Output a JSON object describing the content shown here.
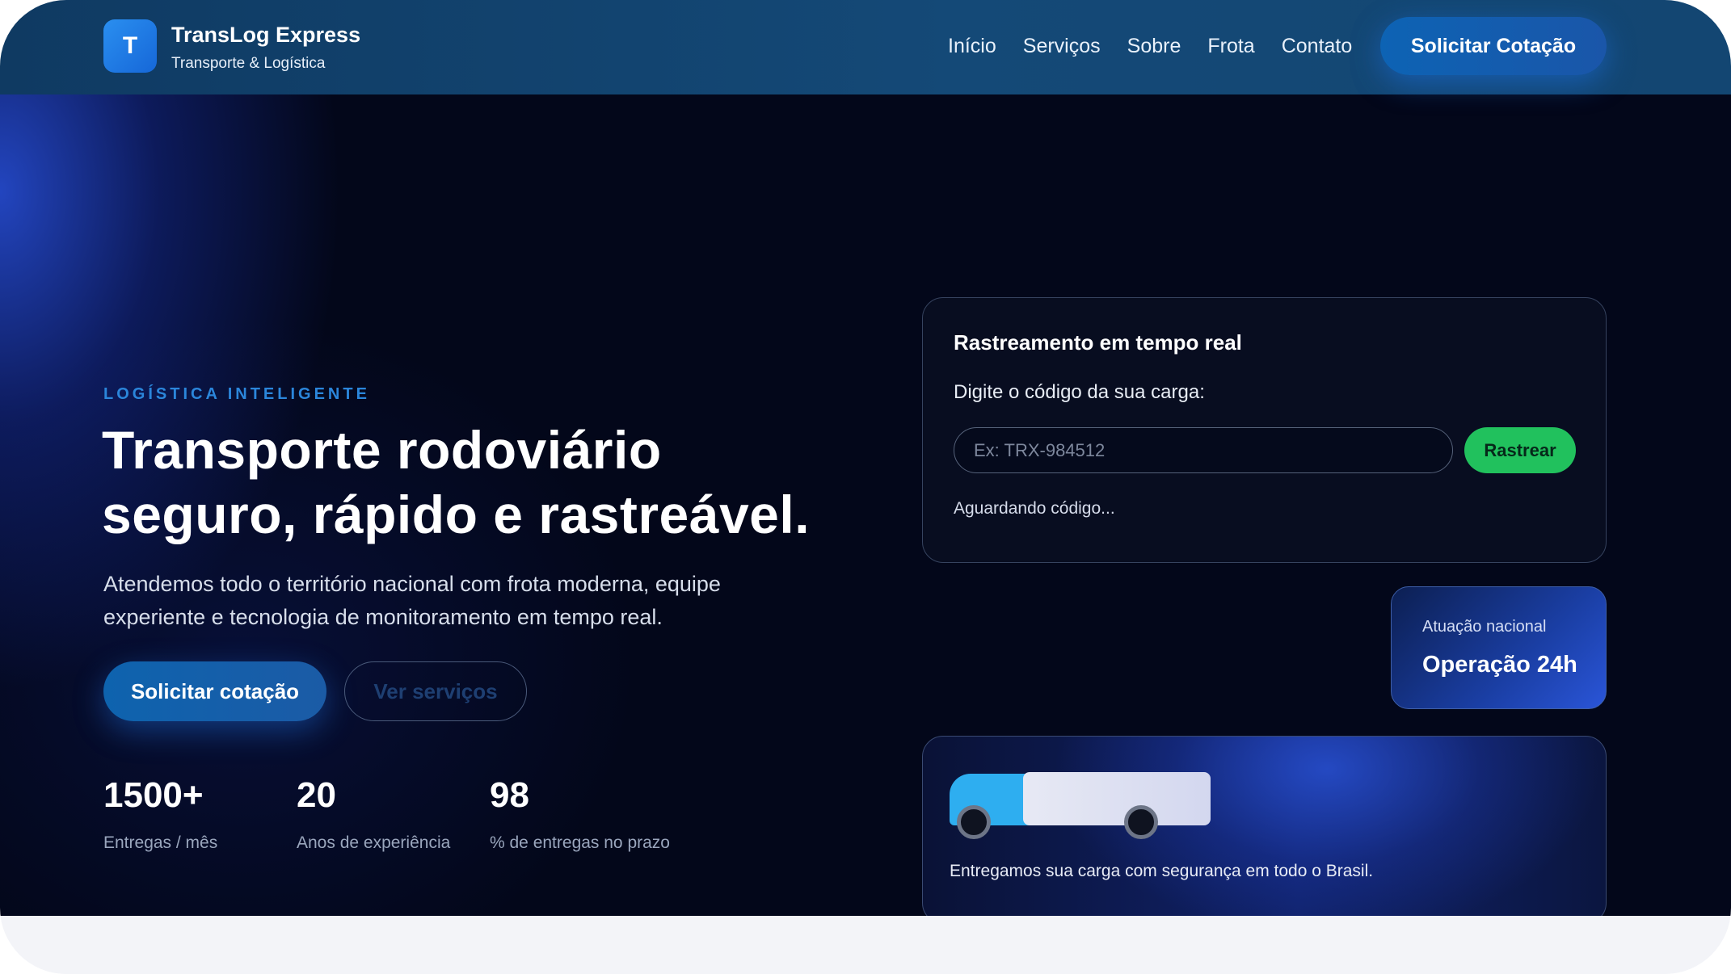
{
  "nav": {
    "brand_initial": "T",
    "brand_name": "TransLog Express",
    "brand_sub": "Transporte & Logística",
    "links": [
      "Início",
      "Serviços",
      "Sobre",
      "Frota",
      "Contato"
    ],
    "cta": "Solicitar Cotação"
  },
  "hero": {
    "eyebrow": "LOGÍSTICA INTELIGENTE",
    "headline_line1": "Transporte rodoviário",
    "headline_line2": "seguro, rápido e rastreável.",
    "subtext": "Atendemos todo o território nacional com frota moderna, equipe experiente e tecnologia de monitoramento em tempo real.",
    "primary_button": "Solicitar cotação",
    "secondary_button": "Ver serviços",
    "stats": [
      {
        "value": "1500+",
        "label": "Entregas / mês"
      },
      {
        "value": "20",
        "label": "Anos de experiência"
      },
      {
        "value": "98",
        "label": "% de entregas no prazo"
      }
    ]
  },
  "tracking": {
    "title": "Rastreamento em tempo real",
    "label": "Digite o código da sua carga:",
    "placeholder": "Ex: TRX-984512",
    "value": "",
    "button": "Rastrear",
    "status": "Aguardando código..."
  },
  "badge": {
    "sub": "Atuação nacional",
    "main": "Operação 24h"
  },
  "truck_card": {
    "caption": "Entregamos sua carga com segurança em todo o Brasil."
  },
  "colors": {
    "nav_bg": "#144977",
    "accent_blue": "#2b86db",
    "track_button": "#21c15d",
    "hero_bg": "#03071a"
  }
}
